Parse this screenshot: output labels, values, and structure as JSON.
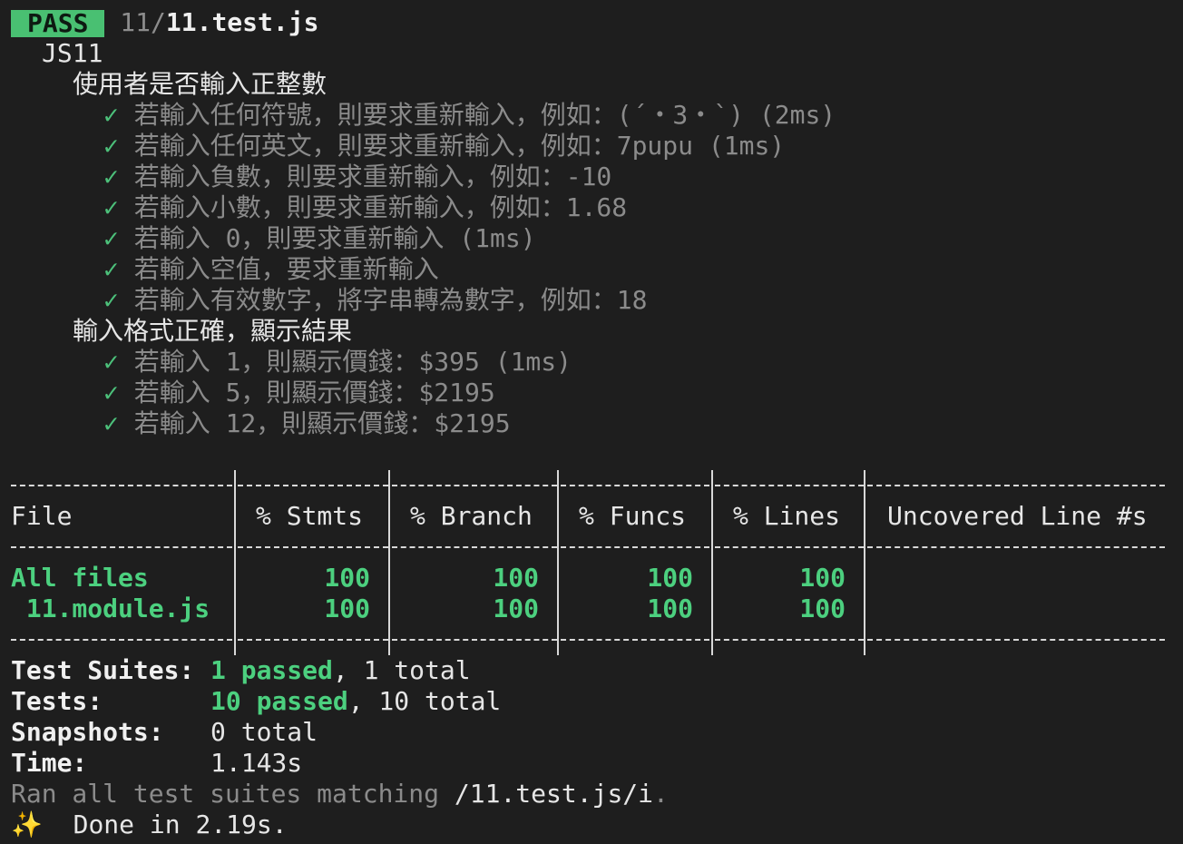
{
  "header": {
    "status_badge": "PASS",
    "path_prefix": "11/",
    "path_file": "11.test.js"
  },
  "suite": {
    "name": "JS11",
    "groups": [
      {
        "title": "使用者是否輸入正整數",
        "tests": [
          {
            "check": "✓",
            "text": "若輸入任何符號，則要求重新輸入，例如：(´・3・`) (2ms)"
          },
          {
            "check": "✓",
            "text": "若輸入任何英文，則要求重新輸入，例如：7pupu (1ms)"
          },
          {
            "check": "✓",
            "text": "若輸入負數，則要求重新輸入，例如：-10"
          },
          {
            "check": "✓",
            "text": "若輸入小數，則要求重新輸入，例如：1.68"
          },
          {
            "check": "✓",
            "text": "若輸入 0，則要求重新輸入 (1ms)"
          },
          {
            "check": "✓",
            "text": "若輸入空值，要求重新輸入"
          },
          {
            "check": "✓",
            "text": "若輸入有效數字，將字串轉為數字，例如：18"
          }
        ]
      },
      {
        "title": "輸入格式正確，顯示結果",
        "tests": [
          {
            "check": "✓",
            "text": "若輸入 1，則顯示價錢：$395 (1ms)"
          },
          {
            "check": "✓",
            "text": "若輸入 5，則顯示價錢：$2195"
          },
          {
            "check": "✓",
            "text": "若輸入 12，則顯示價錢：$2195"
          }
        ]
      }
    ]
  },
  "coverage": {
    "headers": [
      "File",
      "% Stmts",
      "% Branch",
      "% Funcs",
      "% Lines",
      "Uncovered Line #s"
    ],
    "rows": [
      {
        "file": "All files",
        "stmts": "100",
        "branch": "100",
        "funcs": "100",
        "lines": "100",
        "uncovered": ""
      },
      {
        "file": " 11.module.js",
        "stmts": "100",
        "branch": "100",
        "funcs": "100",
        "lines": "100",
        "uncovered": ""
      }
    ]
  },
  "summary": {
    "suites_label": "Test Suites:",
    "suites_passed": "1 passed",
    "suites_total": ", 1 total",
    "tests_label": "Tests:",
    "tests_passed": "10 passed",
    "tests_total": ", 10 total",
    "snapshots_label": "Snapshots:",
    "snapshots_value": "0 total",
    "time_label": "Time:",
    "time_value": "1.143s",
    "ran_prefix": "Ran all test suites matching ",
    "ran_pattern": "/11.test.js/i",
    "ran_suffix": ".",
    "done_icon": "✨",
    "done_text": "Done in 2.19s."
  },
  "colors": {
    "pass_badge": "#49c072",
    "check": "#4cc07a",
    "coverage_green": "#4cd07f",
    "background": "#1e1e1e"
  }
}
